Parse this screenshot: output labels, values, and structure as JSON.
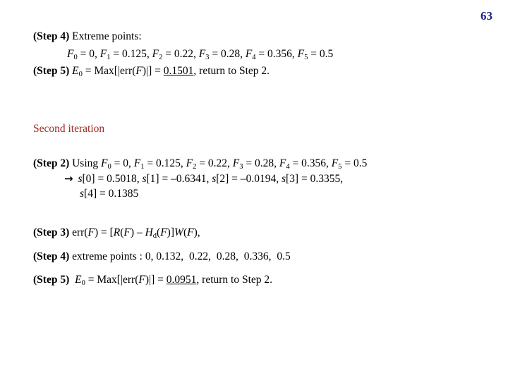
{
  "page": {
    "number": "63",
    "number_color": "#1f1f8c",
    "background_color": "#ffffff"
  },
  "heading": {
    "text": "Second iteration",
    "color": "#9e2a24"
  },
  "block1": {
    "step4": {
      "label": "(Step 4)",
      "text": "Extreme points:",
      "values_line": {
        "F0": "0",
        "F1": "0.125",
        "F2": "0.22",
        "F3": "0.28",
        "F4": "0.356",
        "F5": "0.5"
      }
    },
    "step5": {
      "label": "(Step 5)",
      "lhs": "E",
      "lhs_sub": "0",
      "expr": "= Max[|err(",
      "expr_var": "F",
      "expr_tail": ")|] =",
      "value": "0.1501",
      "trailing": ", return to Step 2."
    }
  },
  "block2": {
    "step2": {
      "label": "(Step 2)",
      "word": "Using",
      "values_line": {
        "F0": "0",
        "F1": "0.125",
        "F2": "0.22",
        "F3": "0.28",
        "F4": "0.356",
        "F5": "0.5"
      }
    },
    "arrow_line": {
      "arrow": "right-arrow",
      "s0": "0.5018",
      "s1": "–0.6341",
      "s2": "–0.0194",
      "s3": "0.3355",
      "s4": "0.1385"
    }
  },
  "block3": {
    "step3": {
      "label": "(Step 3)",
      "formula_prefix": "err(",
      "formula_var": "F",
      "formula_mid": ") = [",
      "R": "R",
      "Hd": "H",
      "Hd_sub": "d",
      "W": "W",
      "formula_suffix": ","
    },
    "step4": {
      "label": "(Step 4)",
      "text": "extreme points :",
      "points": [
        "0",
        "0.132",
        "0.22",
        "0.28",
        "0.336",
        "0.5"
      ]
    },
    "step5": {
      "label": "(Step 5)",
      "lhs": "E",
      "lhs_sub": "0",
      "expr": "= Max[|err(",
      "expr_var": "F",
      "expr_tail": ")|] =",
      "value": "0.0951",
      "trailing": ", return to Step 2."
    }
  },
  "symbols": {
    "F": "F",
    "s": "s",
    "equals": "=",
    "comma": ",",
    "bracket_open": "[",
    "bracket_close": "]",
    "paren_open": "(",
    "paren_close": ")",
    "minus": "–",
    "arrow_glyph": "→"
  }
}
